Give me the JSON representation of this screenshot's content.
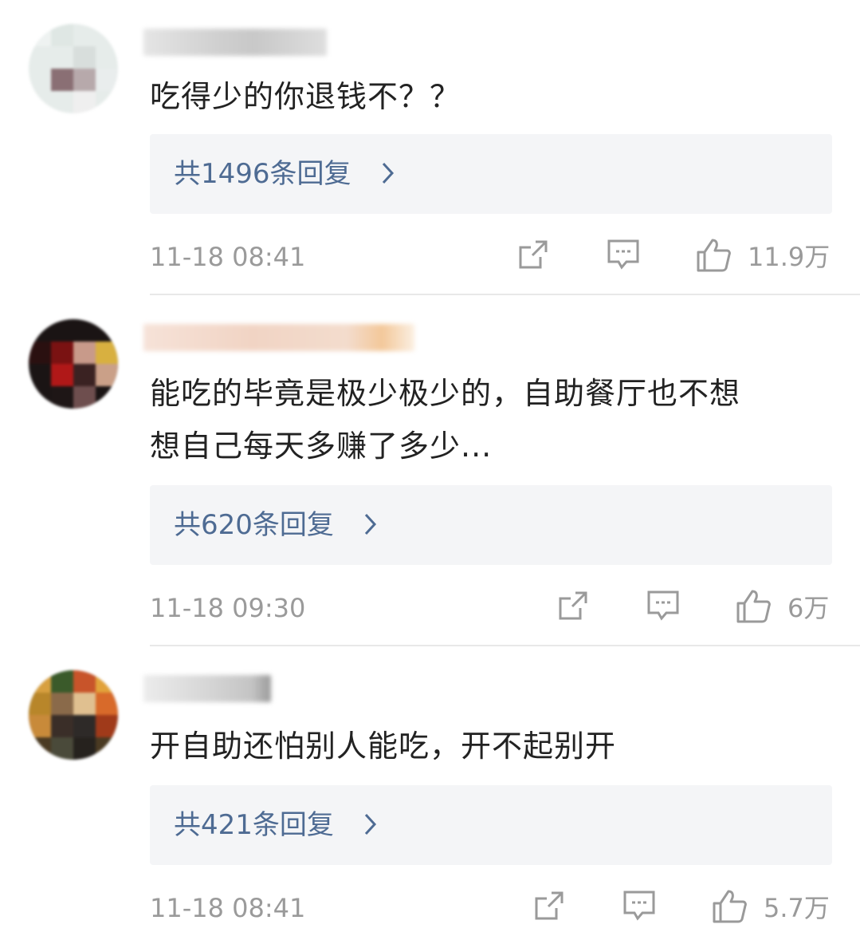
{
  "comments": [
    {
      "text": "吃得少的你退钱不？？",
      "reply_label": "共1496条回复",
      "timestamp": "11-18 08:41",
      "likes": "11.9万"
    },
    {
      "text": "能吃的毕竟是极少极少的，自助餐厅也不想\n想自己每天多赚了多少...",
      "reply_label": "共620条回复",
      "timestamp": "11-18 09:30",
      "likes": "6万"
    },
    {
      "text": "开自助还怕别人能吃，开不起别开",
      "reply_label": "共421条回复",
      "timestamp": "11-18 08:41",
      "likes": "5.7万"
    }
  ],
  "icons": {
    "share": "share-icon",
    "reply": "comment-icon",
    "like": "thumbs-up-icon",
    "chevron": "chevron-right-icon"
  },
  "colors": {
    "text": "#222222",
    "reply_link": "#4e6b93",
    "meta": "#9a9a9a",
    "reply_bg": "#f4f5f7",
    "divider": "#e8e8e8"
  }
}
